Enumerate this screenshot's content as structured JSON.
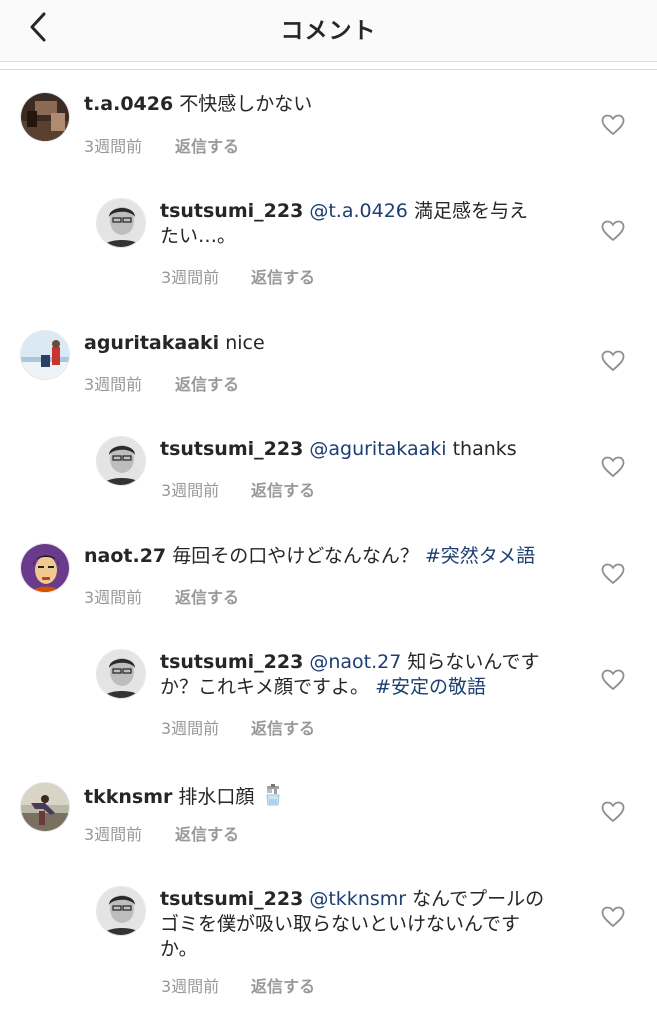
{
  "header": {
    "title": "コメント"
  },
  "comments": [
    {
      "user": "t.a.0426",
      "text": "不快感しかない",
      "time": "3週間前",
      "reply": "返信する"
    },
    {
      "user": "tsutsumi_223",
      "mention": "@t.a.0426",
      "text_line1": "満足感を与え",
      "text_line2": "たい…。",
      "time": "3週間前",
      "reply": "返信する"
    },
    {
      "user": "aguritakaaki",
      "text": "nice",
      "time": "3週間前",
      "reply": "返信する"
    },
    {
      "user": "tsutsumi_223",
      "mention": "@aguritakaaki",
      "text": "thanks",
      "time": "3週間前",
      "reply": "返信する"
    },
    {
      "user": "naot.27",
      "text": "毎回その口やけどなんなん？",
      "hashtag": "#突然タメ語",
      "time": "3週間前",
      "reply": "返信する"
    },
    {
      "user": "tsutsumi_223",
      "mention": "@naot.27",
      "text_line1": "知らないんです",
      "text_line2": "か？これキメ顔ですよ。",
      "hashtag": "#安定の敬語",
      "time": "3週間前",
      "reply": "返信する"
    },
    {
      "user": "tkknsmr",
      "text": "排水口顔",
      "emoji": "faucet-icon",
      "time": "3週間前",
      "reply": "返信する"
    },
    {
      "user": "tsutsumi_223",
      "mention": "@tkknsmr",
      "text_line1": "なんでプールの",
      "text_line2": "ゴミを僕が吸い取らないといけないんです",
      "text_line3": "か。",
      "time": "3週間前",
      "reply": "返信する"
    }
  ]
}
